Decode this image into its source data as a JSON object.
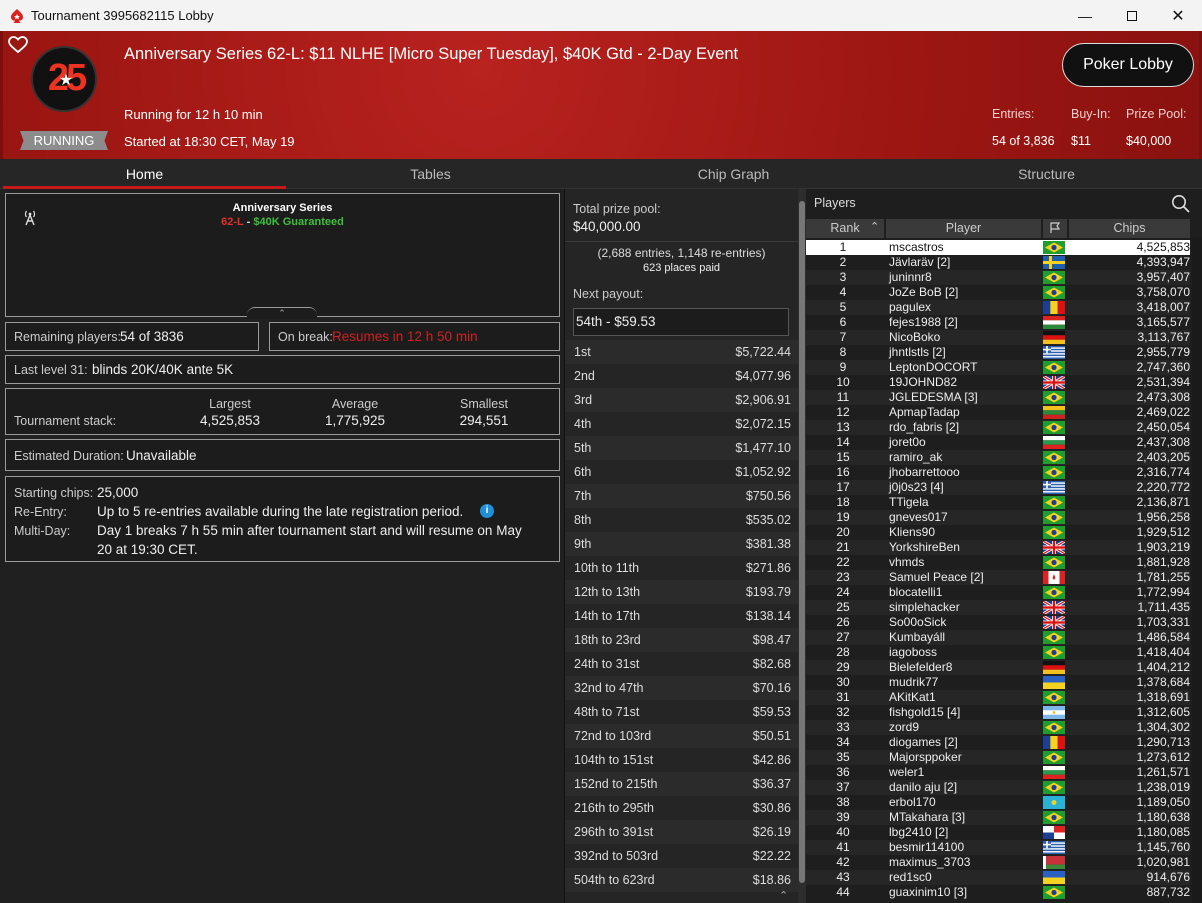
{
  "window": {
    "title": "Tournament 3995682115 Lobby"
  },
  "header": {
    "title": "Anniversary Series 62-L: $11 NLHE [Micro Super Tuesday], $40K Gtd - 2-Day Event",
    "running_for": "Running for 12 h 10 min",
    "started": "Started at 18:30 CET, May 19",
    "status": "RUNNING",
    "badge": "25",
    "lobby_button": "Poker Lobby",
    "entries_label": "Entries:",
    "entries_value": "54 of 3,836",
    "buyin_label": "Buy-In:",
    "buyin_value": "$11",
    "prizepool_label": "Prize Pool:",
    "prizepool_value": "$40,000"
  },
  "tabs": [
    "Home",
    "Tables",
    "Chip Graph",
    "Structure"
  ],
  "home": {
    "series_name": "Anniversary Series",
    "series_code": "62-L",
    "series_sep": " - ",
    "series_gtd": "$40K Guaranteed",
    "remaining_label": "Remaining players:",
    "remaining_value": "54 of 3836",
    "break_label": "On break:",
    "break_value": "Resumes in 12 h 50 min",
    "level_label": "Last level 31:",
    "level_value": "blinds 20K/40K ante 5K",
    "stack_label": "Tournament stack:",
    "stack_cols": [
      {
        "label": "Largest",
        "value": "4,525,853"
      },
      {
        "label": "Average",
        "value": "1,775,925"
      },
      {
        "label": "Smallest",
        "value": "294,551"
      }
    ],
    "duration_label": "Estimated Duration:",
    "duration_value": "Unavailable",
    "starting_chips_label": "Starting chips:",
    "starting_chips_value": "25,000",
    "reentry_label": "Re-Entry:",
    "reentry_value": "Up to 5 re-entries available during the late registration period.",
    "multiday_label": "Multi-Day:",
    "multiday_value_1": "Day 1 breaks 7 h 55 min after tournament start and will resume on May",
    "multiday_value_2": "20 at 19:30 CET."
  },
  "prizes": {
    "total_label": "Total prize pool:",
    "total_value": "$40,000.00",
    "entries_note": "(2,688 entries, 1,148 re-entries)",
    "places_paid": "623 places paid",
    "next_label": "Next payout:",
    "next_value": "54th - $59.53",
    "rows": [
      {
        "place": "1st",
        "amount": "$5,722.44"
      },
      {
        "place": "2nd",
        "amount": "$4,077.96"
      },
      {
        "place": "3rd",
        "amount": "$2,906.91"
      },
      {
        "place": "4th",
        "amount": "$2,072.15"
      },
      {
        "place": "5th",
        "amount": "$1,477.10"
      },
      {
        "place": "6th",
        "amount": "$1,052.92"
      },
      {
        "place": "7th",
        "amount": "$750.56"
      },
      {
        "place": "8th",
        "amount": "$535.02"
      },
      {
        "place": "9th",
        "amount": "$381.38"
      },
      {
        "place": "10th to 11th",
        "amount": "$271.86"
      },
      {
        "place": "12th to 13th",
        "amount": "$193.79"
      },
      {
        "place": "14th to 17th",
        "amount": "$138.14"
      },
      {
        "place": "18th to 23rd",
        "amount": "$98.47"
      },
      {
        "place": "24th to 31st",
        "amount": "$82.68"
      },
      {
        "place": "32nd to 47th",
        "amount": "$70.16"
      },
      {
        "place": "48th to 71st",
        "amount": "$59.53"
      },
      {
        "place": "72nd to 103rd",
        "amount": "$50.51"
      },
      {
        "place": "104th to 151st",
        "amount": "$42.86"
      },
      {
        "place": "152nd to 215th",
        "amount": "$36.37"
      },
      {
        "place": "216th to 295th",
        "amount": "$30.86"
      },
      {
        "place": "296th to 391st",
        "amount": "$26.19"
      },
      {
        "place": "392nd to 503rd",
        "amount": "$22.22"
      },
      {
        "place": "504th to 623rd",
        "amount": "$18.86"
      }
    ]
  },
  "players": {
    "title": "Players",
    "col_rank": "Rank",
    "col_player": "Player",
    "col_chips": "Chips",
    "rows": [
      {
        "rank": "1",
        "name": "mscastros",
        "flag": "br",
        "chips": "4,525,853"
      },
      {
        "rank": "2",
        "name": "Jävlaräv [2]",
        "flag": "se",
        "chips": "4,393,947"
      },
      {
        "rank": "3",
        "name": "juninnr8",
        "flag": "br",
        "chips": "3,957,407"
      },
      {
        "rank": "4",
        "name": "JoZe BoB [2]",
        "flag": "br",
        "chips": "3,758,070"
      },
      {
        "rank": "5",
        "name": "pagulex",
        "flag": "ro",
        "chips": "3,418,007"
      },
      {
        "rank": "6",
        "name": "fejes1988 [2]",
        "flag": "hu",
        "chips": "3,165,577"
      },
      {
        "rank": "7",
        "name": "NicoBoko",
        "flag": "de",
        "chips": "3,113,767"
      },
      {
        "rank": "8",
        "name": "jhntlstls [2]",
        "flag": "gr",
        "chips": "2,955,779"
      },
      {
        "rank": "9",
        "name": "LeptonDOCORT",
        "flag": "br",
        "chips": "2,747,360"
      },
      {
        "rank": "10",
        "name": "19JOHND82",
        "flag": "gb",
        "chips": "2,531,394"
      },
      {
        "rank": "11",
        "name": "JGLEDESMA [3]",
        "flag": "br",
        "chips": "2,473,308"
      },
      {
        "rank": "12",
        "name": "ApmapTadap",
        "flag": "lt",
        "chips": "2,469,022"
      },
      {
        "rank": "13",
        "name": "rdo_fabris [2]",
        "flag": "br",
        "chips": "2,450,054"
      },
      {
        "rank": "14",
        "name": "joret0o",
        "flag": "bg",
        "chips": "2,437,308"
      },
      {
        "rank": "15",
        "name": "ramiro_ak",
        "flag": "br",
        "chips": "2,403,205"
      },
      {
        "rank": "16",
        "name": "jhobarrettooo",
        "flag": "br",
        "chips": "2,316,774"
      },
      {
        "rank": "17",
        "name": "j0j0s23 [4]",
        "flag": "gr",
        "chips": "2,220,772"
      },
      {
        "rank": "18",
        "name": "TTigela",
        "flag": "br",
        "chips": "2,136,871"
      },
      {
        "rank": "19",
        "name": "gneves017",
        "flag": "br",
        "chips": "1,956,258"
      },
      {
        "rank": "20",
        "name": "Kliens90",
        "flag": "br",
        "chips": "1,929,512"
      },
      {
        "rank": "21",
        "name": "YorkshireBen",
        "flag": "gb",
        "chips": "1,903,219"
      },
      {
        "rank": "22",
        "name": "vhmds",
        "flag": "br",
        "chips": "1,881,928"
      },
      {
        "rank": "23",
        "name": "Samuel Peace [2]",
        "flag": "ca",
        "chips": "1,781,255"
      },
      {
        "rank": "24",
        "name": "blocatelli1",
        "flag": "br",
        "chips": "1,772,994"
      },
      {
        "rank": "25",
        "name": "simplehacker",
        "flag": "gb",
        "chips": "1,711,435"
      },
      {
        "rank": "26",
        "name": "So00oSick",
        "flag": "gb",
        "chips": "1,703,331"
      },
      {
        "rank": "27",
        "name": "Kumbayáll",
        "flag": "br",
        "chips": "1,486,584"
      },
      {
        "rank": "28",
        "name": "iagoboss",
        "flag": "br",
        "chips": "1,418,404"
      },
      {
        "rank": "29",
        "name": "Bielefelder8",
        "flag": "de",
        "chips": "1,404,212"
      },
      {
        "rank": "30",
        "name": "mudrik77",
        "flag": "ua",
        "chips": "1,378,684"
      },
      {
        "rank": "31",
        "name": "AKitKat1",
        "flag": "br",
        "chips": "1,318,691"
      },
      {
        "rank": "32",
        "name": "fishgold15 [4]",
        "flag": "ar",
        "chips": "1,312,605"
      },
      {
        "rank": "33",
        "name": "zord9",
        "flag": "br",
        "chips": "1,304,302"
      },
      {
        "rank": "34",
        "name": "diogames [2]",
        "flag": "ro",
        "chips": "1,290,713"
      },
      {
        "rank": "35",
        "name": "Majorsppoker",
        "flag": "br",
        "chips": "1,273,612"
      },
      {
        "rank": "36",
        "name": "weler1",
        "flag": "bg",
        "chips": "1,261,571"
      },
      {
        "rank": "37",
        "name": "danilo aju [2]",
        "flag": "br",
        "chips": "1,238,019"
      },
      {
        "rank": "38",
        "name": "erbol170",
        "flag": "kz",
        "chips": "1,189,050"
      },
      {
        "rank": "39",
        "name": "MTakahara [3]",
        "flag": "br",
        "chips": "1,180,638"
      },
      {
        "rank": "40",
        "name": "lbg2410 [2]",
        "flag": "pa",
        "chips": "1,180,085"
      },
      {
        "rank": "41",
        "name": "besmir114100",
        "flag": "gr",
        "chips": "1,145,760"
      },
      {
        "rank": "42",
        "name": "maximus_3703",
        "flag": "by",
        "chips": "1,020,981"
      },
      {
        "rank": "43",
        "name": "red1sc0",
        "flag": "ua",
        "chips": "914,676"
      },
      {
        "rank": "44",
        "name": "guaxinim10 [3]",
        "flag": "br",
        "chips": "887,732"
      }
    ]
  },
  "colors": {
    "accent": "#c41a1a",
    "header_red": "#a5191a",
    "highlight_green": "#3cc13c",
    "break_red": "#d02020"
  }
}
